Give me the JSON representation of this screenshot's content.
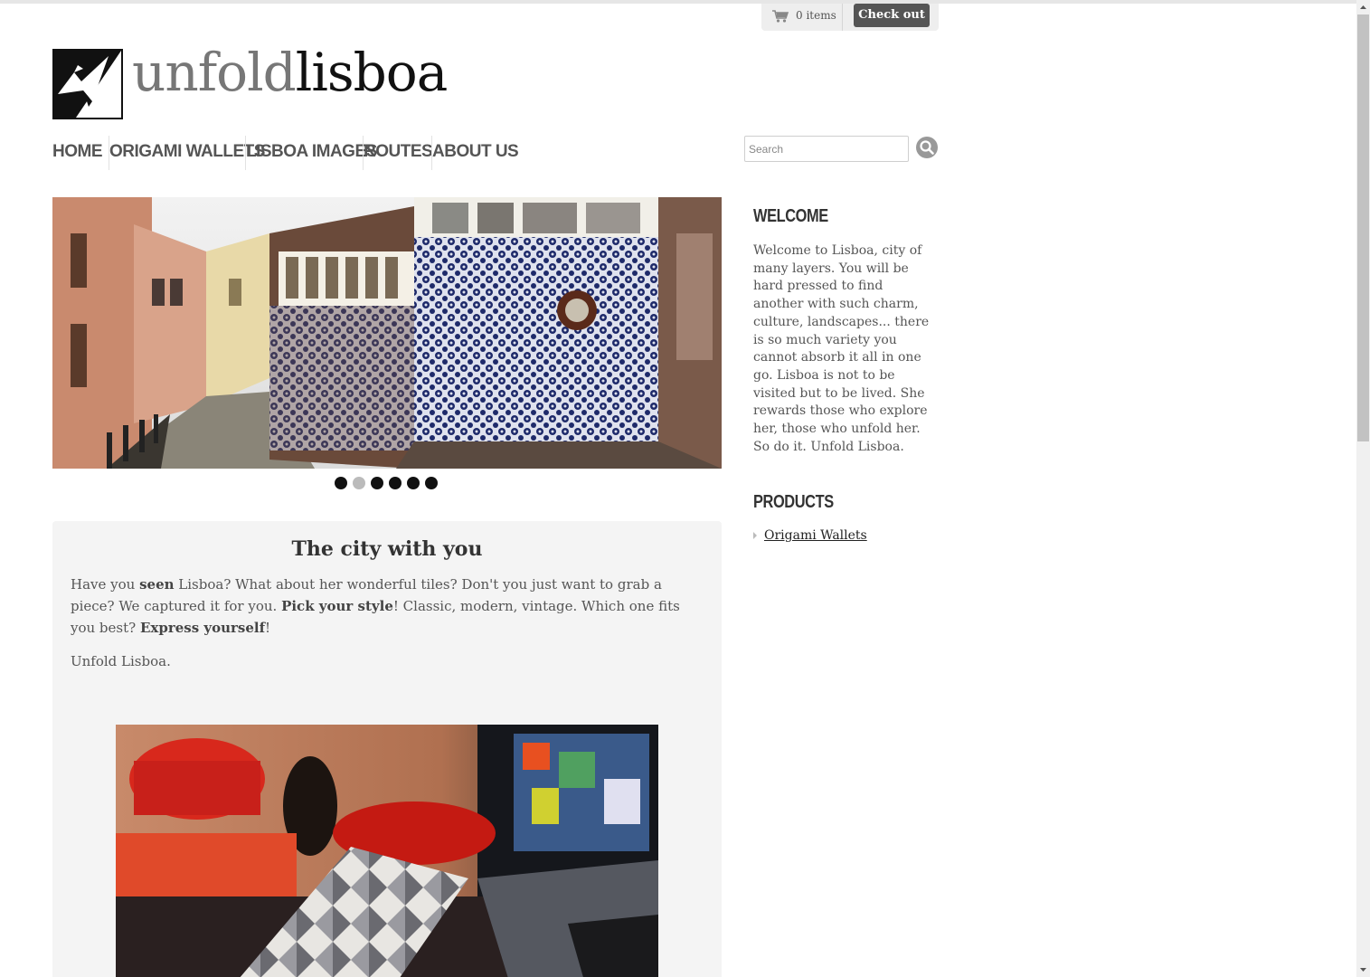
{
  "cart": {
    "count_label": "0 items",
    "checkout_label": "Check out"
  },
  "logo": {
    "part1": "unfold",
    "part2": "lisboa"
  },
  "nav": {
    "items": [
      "Home",
      "Origami Wallets",
      "Lisboa Images",
      "Routes",
      "About us"
    ]
  },
  "search": {
    "placeholder": "Search",
    "value": ""
  },
  "slideshow": {
    "active_index": 1,
    "total": 6
  },
  "main": {
    "title": "The city with you",
    "para_1": "Have you ",
    "para_seen": "seen",
    "para_2": " Lisboa? What about her wonderful tiles? Don't you just want to grab a piece? We captured it for you. ",
    "para_pick": "Pick your style",
    "para_3": "! Classic, modern, vintage. Which one fits you best? ",
    "para_express": "Express yourself",
    "para_4": "!",
    "signature": "Unfold Lisboa."
  },
  "sidebar": {
    "welcome_heading": "Welcome",
    "welcome_text": "Welcome to Lisboa, city of many layers. You will be hard pressed to find another with such charm, culture, landscapes... there is so much variety you cannot absorb it all in one go. Lisboa is not to be visited but to be lived. She rewards those who explore her, those who unfold her. So do it. Unfold Lisboa.",
    "products_heading": "Products",
    "products": [
      "Origami Wallets"
    ]
  },
  "colors": {
    "accent": "#555555",
    "content_bg": "#f4f4f4"
  }
}
